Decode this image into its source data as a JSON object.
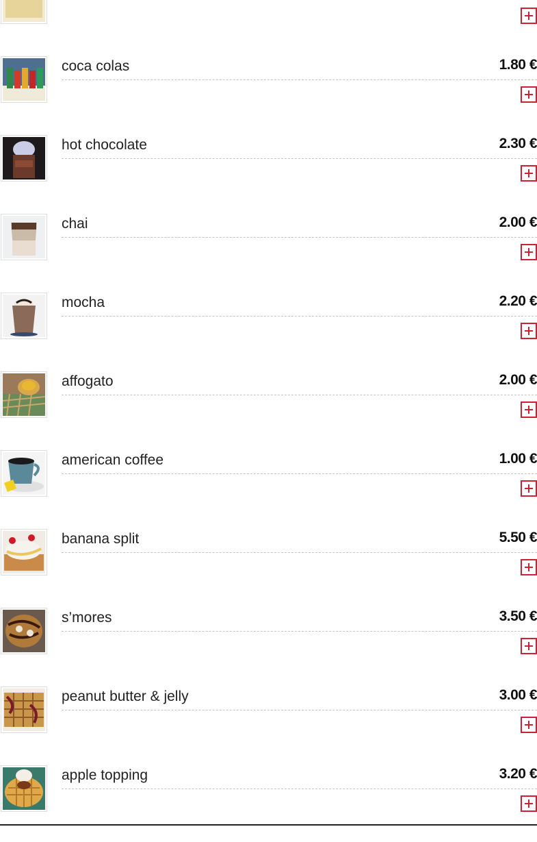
{
  "menu": {
    "currency": "€",
    "items": [
      {
        "name": "",
        "price": "",
        "image": "waffle-thumbnail",
        "add_icon": "plus-icon"
      },
      {
        "name": "coca colas",
        "price": "1.80 €",
        "image": "soda-cans-photo",
        "add_icon": "plus-icon"
      },
      {
        "name": "hot chocolate",
        "price": "2.30 €",
        "image": "hot-chocolate-photo",
        "add_icon": "plus-icon"
      },
      {
        "name": "chai",
        "price": "2.00 €",
        "image": "chai-photo",
        "add_icon": "plus-icon"
      },
      {
        "name": "mocha",
        "price": "2.20 €",
        "image": "mocha-photo",
        "add_icon": "plus-icon"
      },
      {
        "name": "affogato",
        "price": "2.00 €",
        "image": "affogato-photo",
        "add_icon": "plus-icon"
      },
      {
        "name": "american coffee",
        "price": "1.00 €",
        "image": "coffee-cup-photo",
        "add_icon": "plus-icon"
      },
      {
        "name": "banana split",
        "price": "5.50 €",
        "image": "banana-split-waffle-photo",
        "add_icon": "plus-icon"
      },
      {
        "name": "s’mores",
        "price": "3.50 €",
        "image": "smores-waffle-photo",
        "add_icon": "plus-icon"
      },
      {
        "name": "peanut butter & jelly",
        "price": "3.00 €",
        "image": "pbj-waffle-photo",
        "add_icon": "plus-icon"
      },
      {
        "name": "apple topping",
        "price": "3.20 €",
        "image": "apple-waffle-photo",
        "add_icon": "plus-icon"
      }
    ]
  },
  "colors": {
    "accent": "#cc2233",
    "divider": "#c4c4c4",
    "text": "#222222"
  }
}
